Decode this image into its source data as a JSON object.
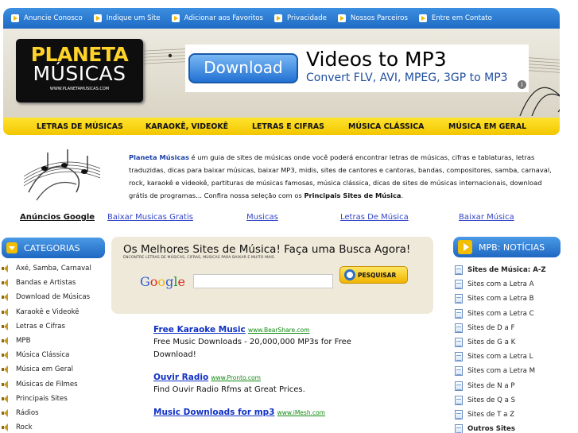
{
  "topnav": {
    "items": [
      "Anuncie Conosco",
      "Indique um Site",
      "Adicionar aos Favoritos",
      "Privacidade",
      "Nossos Parceiros",
      "Entre em Contato"
    ]
  },
  "logo": {
    "line1": "PLANETA",
    "line2": "MÚSICAS",
    "url": "WWW.PLANETAMUSICAS.COM"
  },
  "banner_ad": {
    "button": "Download",
    "headline": "Videos to MP3",
    "subline": "Convert FLV, AVI, MPEG, 3GP to MP3"
  },
  "catbar": {
    "items": [
      "LETRAS DE MÚSICAS",
      "KARAOKÊ, VIDEOKÊ",
      "LETRAS E CIFRAS",
      "MÚSICA CLÁSSICA",
      "MÚSICA EM GERAL"
    ]
  },
  "intro": {
    "brand": "Planeta Músicas",
    "text": " é um guia de sites de músicas onde você poderá encontrar letras de músicas, cifras e tablaturas, letras traduzidas, dicas para baixar músicas, baixar MP3, midis, sites de cantores e cantoras, bandas, compositores, samba, carnaval, rock, karaokê e videokê, partituras de músicas famosas, música clássica, dicas de sites de músicas internacionais, download grátis de programas... Confira nossa seleção com os ",
    "strong_tail": "Principais Sites de Música",
    "end": "."
  },
  "linkrow": {
    "label": "Anúncios Google",
    "links": [
      "Baixar Musicas Gratis",
      "Musicas",
      "Letras De Música",
      "Baixar Música"
    ]
  },
  "categorias": {
    "title": "CATEGORIAS",
    "items": [
      "Axé, Samba, Carnaval",
      "Bandas e Artistas",
      "Download de Músicas",
      "Karaokê e Videokê",
      "Letras e Cifras",
      "MPB",
      "Música Clássica",
      "Música em Geral",
      "Músicas de Filmes",
      "Principais Sites",
      "Rádios",
      "Rock"
    ]
  },
  "search": {
    "title": "Os Melhores Sites de Música!  Faça uma Busca Agora!",
    "subtitle": "ENCONTRE LETRAS DE MÚSICAS, CIFRAS, MÚSICAS PARA BAIXAR E MUITO MAIS",
    "google": "Google",
    "button": "PESQUISAR",
    "query": ""
  },
  "ads": [
    {
      "title": "Free Karaoke Music",
      "url": "www.BearShare.com",
      "desc": "Free Music Downloads - 20,000,000 MP3s for Free Download!"
    },
    {
      "title": "Ouvir Radio",
      "url": "www.Pronto.com",
      "desc": "Find Ouvir Radio Rfms at Great Prices."
    },
    {
      "title": "Music Downloads for mp3",
      "url": "www.iMesh.com",
      "desc": ""
    }
  ],
  "noticias": {
    "title": "MPB: NOTÍCIAS",
    "items": [
      "Sites de Música: A-Z",
      "Sites com a Letra A",
      "Sites com a Letra B",
      "Sites com a Letra C",
      "Sites de D a F",
      "Sites de G a K",
      "Sites com a Letra L",
      "Sites com a Letra M",
      "Sites de N a P",
      "Sites de Q a S",
      "Sites de T a Z",
      "Outros Sites"
    ]
  }
}
